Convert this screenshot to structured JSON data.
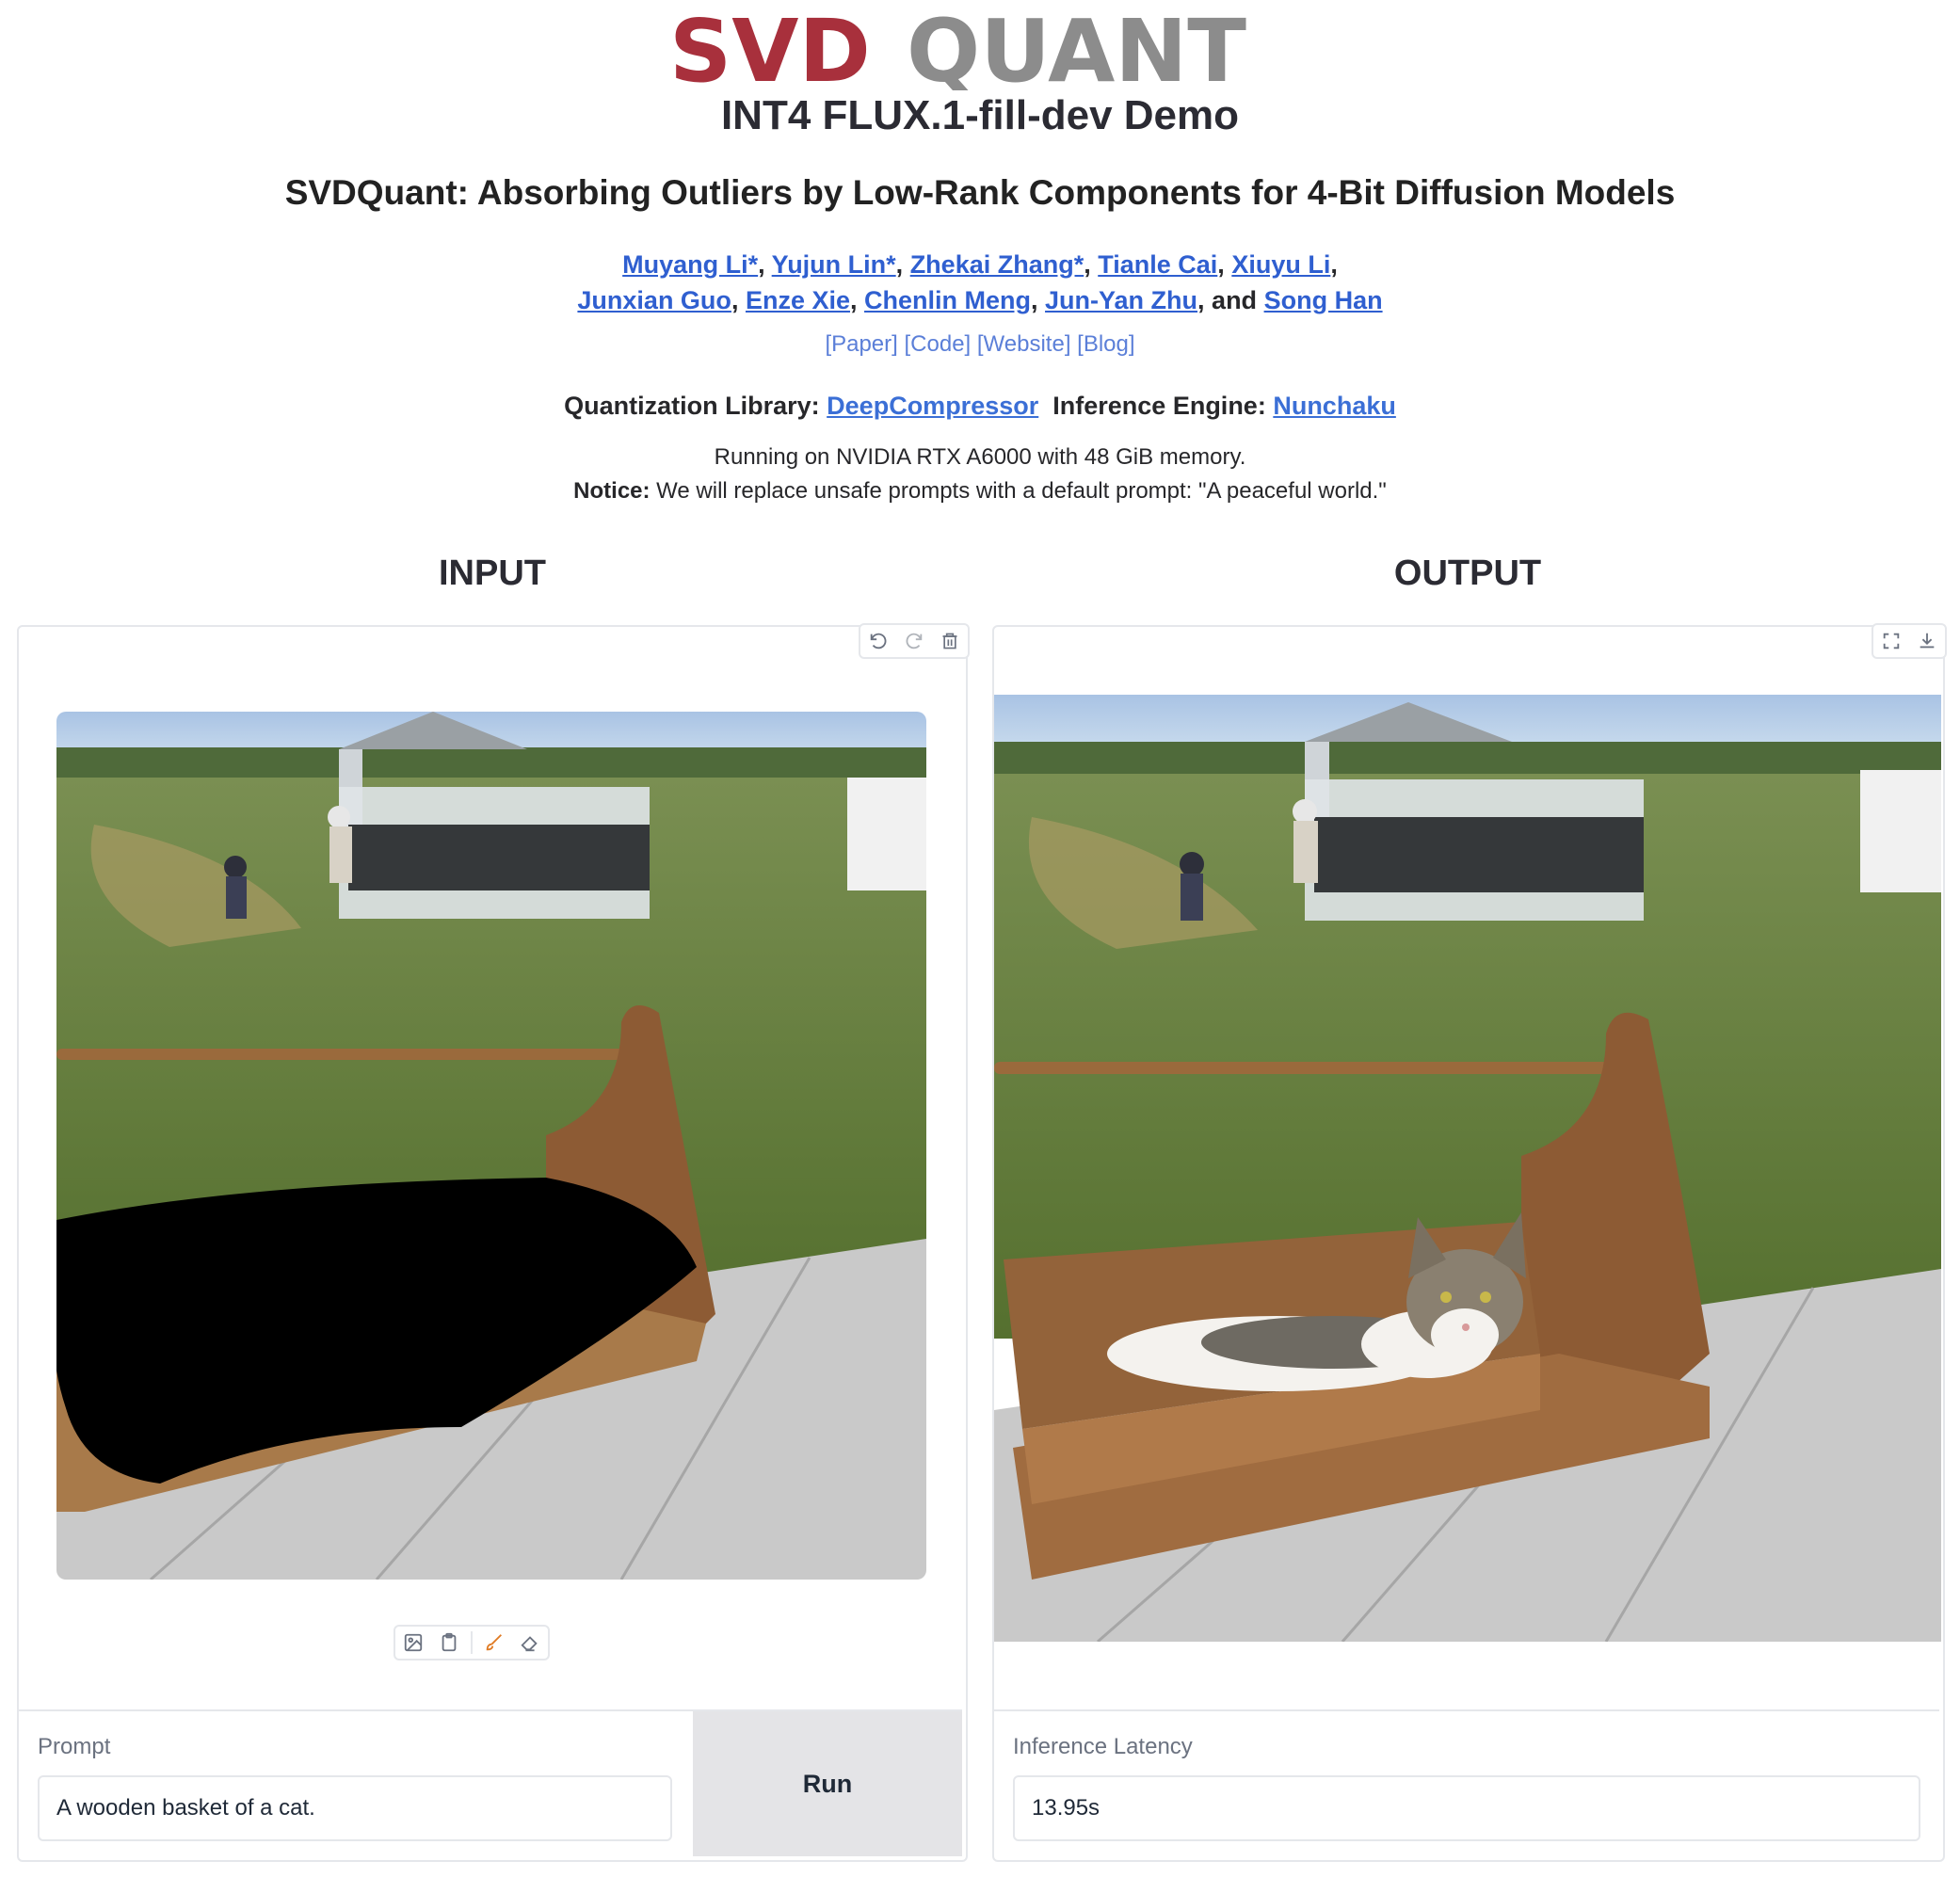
{
  "header": {
    "logo_text_left": "SVD",
    "logo_text_right": "QUANT",
    "subtitle": "INT4 FLUX.1-fill-dev Demo",
    "paper_title": "SVDQuant: Absorbing Outliers by Low-Rank Components for 4-Bit Diffusion Models",
    "authors_line1": [
      "Muyang Li*",
      "Yujun Lin*",
      "Zhekai Zhang*",
      "Tianle Cai",
      "Xiuyu Li"
    ],
    "authors_line2": [
      "Junxian Guo",
      "Enze Xie",
      "Chenlin Meng",
      "Jun-Yan Zhu"
    ],
    "authors_last": "Song Han",
    "and_text": "and",
    "links": [
      "[Paper]",
      "[Code]",
      "[Website]",
      "[Blog]"
    ],
    "quant_label": "Quantization Library:",
    "quant_link": "DeepCompressor",
    "engine_label": "Inference Engine:",
    "engine_link": "Nunchaku",
    "running_text": "Running on NVIDIA RTX A6000 with 48 GiB memory.",
    "notice_label": "Notice:",
    "notice_text": " We will replace unsafe prompts with a default prompt: \"A peaceful world.\""
  },
  "input": {
    "heading": "INPUT",
    "toolbar_icons": [
      "undo-icon",
      "redo-icon",
      "trash-icon"
    ],
    "tool_icons": [
      "image-upload-icon",
      "paste-icon",
      "brush-icon",
      "eraser-icon"
    ],
    "prompt_label": "Prompt",
    "prompt_value": "A wooden basket of a cat.",
    "run_label": "Run"
  },
  "output": {
    "heading": "OUTPUT",
    "toolbar_icons": [
      "fullscreen-icon",
      "download-icon"
    ],
    "latency_label": "Inference Latency",
    "latency_value": "13.95s"
  },
  "colors": {
    "logo_red": "#a8303c",
    "logo_gray": "#8c8c8c",
    "link": "#2f5fd0"
  }
}
